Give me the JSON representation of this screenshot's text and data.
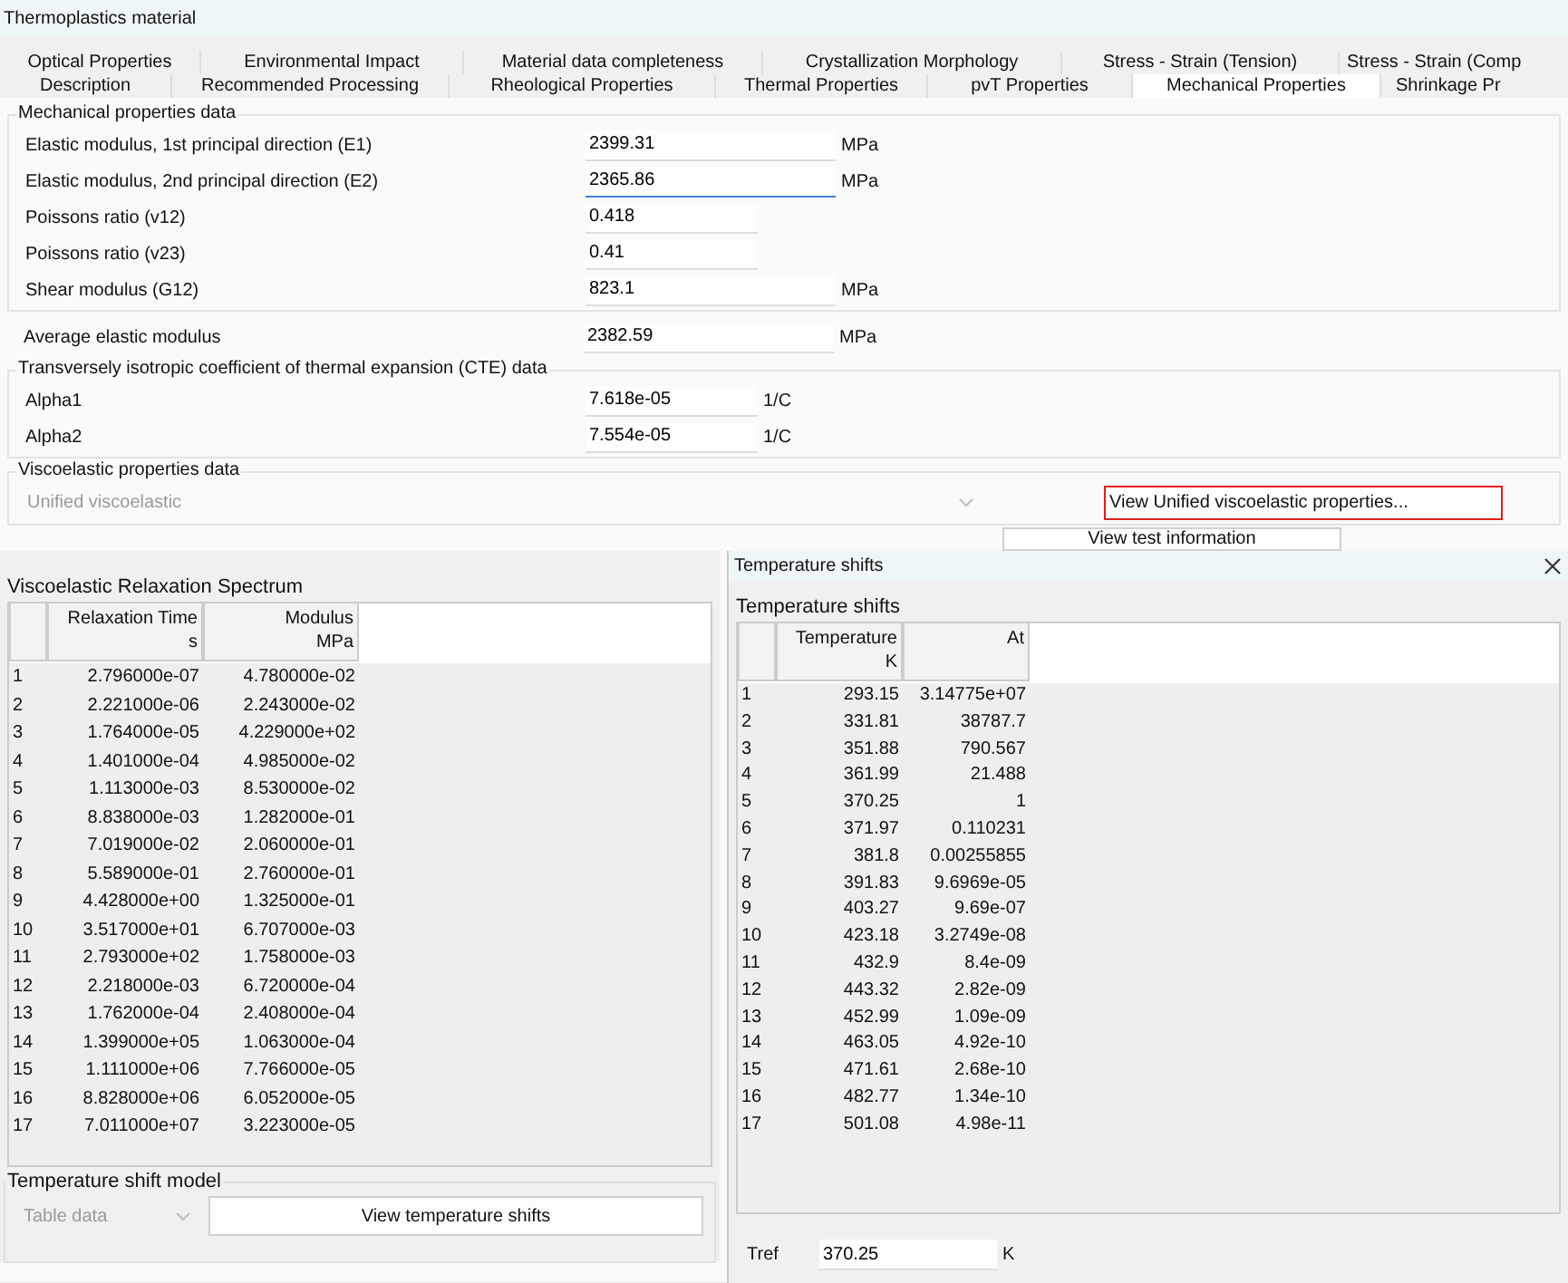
{
  "window": {
    "title": "Thermoplastics material"
  },
  "tab_rows": [
    [
      {
        "label": "Optical Properties",
        "selected": false
      },
      {
        "label": "Environmental Impact",
        "selected": false
      },
      {
        "label": "Material data completeness",
        "selected": false
      },
      {
        "label": "Crystallization Morphology",
        "selected": false
      },
      {
        "label": "Stress - Strain (Tension)",
        "selected": false
      },
      {
        "label": "Stress - Strain (Comp",
        "selected": false
      }
    ],
    [
      {
        "label": "Description",
        "selected": false
      },
      {
        "label": "Recommended Processing",
        "selected": false
      },
      {
        "label": "Rheological Properties",
        "selected": false
      },
      {
        "label": "Thermal Properties",
        "selected": false
      },
      {
        "label": "pvT Properties",
        "selected": false
      },
      {
        "label": "Mechanical Properties",
        "selected": true
      },
      {
        "label": "Shrinkage Pr",
        "selected": false
      }
    ]
  ],
  "mechanical": {
    "title": "Mechanical properties data",
    "fields": [
      {
        "label": "Elastic modulus, 1st principal direction (E1)",
        "value": "2399.31",
        "unit": "MPa",
        "kind": "wide",
        "focused": false
      },
      {
        "label": "Elastic modulus, 2nd principal direction (E2)",
        "value": "2365.86",
        "unit": "MPa",
        "kind": "wide",
        "focused": true
      },
      {
        "label": "Poissons ratio (v12)",
        "value": "0.418",
        "kind": "narrow",
        "focused": false
      },
      {
        "label": "Poissons ratio (v23)",
        "value": "0.41",
        "kind": "narrow",
        "focused": false
      },
      {
        "label": "Shear modulus (G12)",
        "value": "823.1",
        "unit": "MPa",
        "kind": "wide",
        "focused": false
      }
    ]
  },
  "average": {
    "label": "Average elastic modulus",
    "value": "2382.59",
    "unit": "MPa",
    "kind": "wide",
    "focused": false
  },
  "cte": {
    "title": "Transversely isotropic coefficient of thermal expansion (CTE) data",
    "fields": [
      {
        "label": "Alpha1",
        "value": "7.618e-05",
        "unit": "1/C",
        "kind": "narrow",
        "focused": false
      },
      {
        "label": "Alpha2",
        "value": "7.554e-05",
        "unit": "1/C",
        "kind": "narrow",
        "focused": false
      }
    ]
  },
  "viscoelastic": {
    "title": "Viscoelastic properties data",
    "model": {
      "value": "Unified viscoelastic",
      "disabled": true
    },
    "properties_button": {
      "label": "View Unified viscoelastic properties...",
      "highlighted": true
    },
    "test_button": {
      "label": "View test information"
    }
  },
  "spectrum": {
    "title": "Viscoelastic Relaxation Spectrum",
    "columns": [
      {
        "title": "Relaxation Time",
        "unit": "s"
      },
      {
        "title": "Modulus",
        "unit": "MPa"
      }
    ],
    "rows": [
      {
        "index": "1",
        "values": [
          "2.796000e-07",
          "4.780000e-02"
        ]
      },
      {
        "index": "2",
        "values": [
          "2.221000e-06",
          "2.243000e-02"
        ]
      },
      {
        "index": "3",
        "values": [
          "1.764000e-05",
          "4.229000e+02"
        ]
      },
      {
        "index": "4",
        "values": [
          "1.401000e-04",
          "4.985000e-02"
        ]
      },
      {
        "index": "5",
        "values": [
          "1.113000e-03",
          "8.530000e-02"
        ]
      },
      {
        "index": "6",
        "values": [
          "8.838000e-03",
          "1.282000e-01"
        ]
      },
      {
        "index": "7",
        "values": [
          "7.019000e-02",
          "2.060000e-01"
        ]
      },
      {
        "index": "8",
        "values": [
          "5.589000e-01",
          "2.760000e-01"
        ]
      },
      {
        "index": "9",
        "values": [
          "4.428000e+00",
          "1.325000e-01"
        ]
      },
      {
        "index": "10",
        "values": [
          "3.517000e+01",
          "6.707000e-03"
        ]
      },
      {
        "index": "11",
        "values": [
          "2.793000e+02",
          "1.758000e-03"
        ]
      },
      {
        "index": "12",
        "values": [
          "2.218000e-03",
          "6.720000e-04"
        ]
      },
      {
        "index": "13",
        "values": [
          "1.762000e-04",
          "2.408000e-04"
        ]
      },
      {
        "index": "14",
        "values": [
          "1.399000e+05",
          "1.063000e-04"
        ]
      },
      {
        "index": "15",
        "values": [
          "1.111000e+06",
          "7.766000e-05"
        ]
      },
      {
        "index": "16",
        "values": [
          "8.828000e+06",
          "6.052000e-05"
        ]
      },
      {
        "index": "17",
        "values": [
          "7.011000e+07",
          "3.223000e-05"
        ]
      }
    ]
  },
  "shift_model": {
    "title": "Temperature shift model",
    "model": {
      "value": "Table data",
      "disabled": true
    },
    "button": "View temperature shifts"
  },
  "dialog": {
    "title": "Temperature shifts",
    "group_title": "Temperature shifts",
    "columns": [
      {
        "title": "Temperature",
        "unit": "K"
      },
      {
        "title": "At"
      }
    ],
    "rows": [
      {
        "index": "1",
        "values": [
          "293.15",
          "3.14775e+07"
        ]
      },
      {
        "index": "2",
        "values": [
          "331.81",
          "38787.7"
        ]
      },
      {
        "index": "3",
        "values": [
          "351.88",
          "790.567"
        ]
      },
      {
        "index": "4",
        "values": [
          "361.99",
          "21.488"
        ]
      },
      {
        "index": "5",
        "values": [
          "370.25",
          "1"
        ]
      },
      {
        "index": "6",
        "values": [
          "371.97",
          "0.110231"
        ]
      },
      {
        "index": "7",
        "values": [
          "381.8",
          "0.00255855"
        ]
      },
      {
        "index": "8",
        "values": [
          "391.83",
          "9.6969e-05"
        ]
      },
      {
        "index": "9",
        "values": [
          "403.27",
          "9.69e-07"
        ]
      },
      {
        "index": "10",
        "values": [
          "423.18",
          "3.2749e-08"
        ]
      },
      {
        "index": "11",
        "values": [
          "432.9",
          "8.4e-09"
        ]
      },
      {
        "index": "12",
        "values": [
          "443.32",
          "2.82e-09"
        ]
      },
      {
        "index": "13",
        "values": [
          "452.99",
          "1.09e-09"
        ]
      },
      {
        "index": "14",
        "values": [
          "463.05",
          "4.92e-10"
        ]
      },
      {
        "index": "15",
        "values": [
          "471.61",
          "2.68e-10"
        ]
      },
      {
        "index": "16",
        "values": [
          "482.77",
          "1.34e-10"
        ]
      },
      {
        "index": "17",
        "values": [
          "501.08",
          "4.98e-11"
        ]
      }
    ],
    "tref": {
      "label": "Tref",
      "value": "370.25",
      "unit": "K"
    }
  }
}
